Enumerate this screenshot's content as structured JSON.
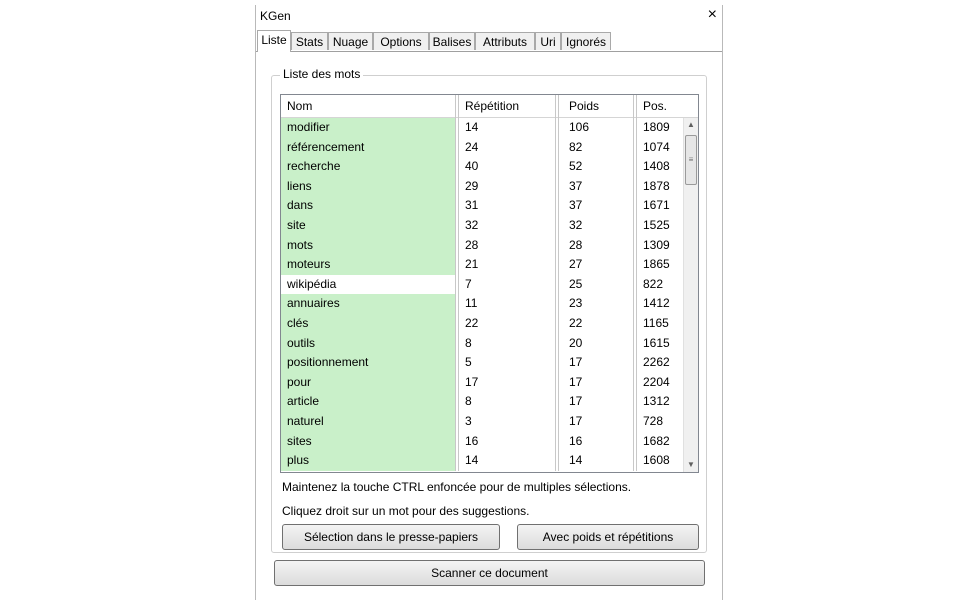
{
  "window": {
    "title": "KGen",
    "close_label": "×"
  },
  "tabs": [
    "Liste",
    "Stats",
    "Nuage",
    "Options",
    "Balises",
    "Attributs",
    "Uri",
    "Ignorés"
  ],
  "group": {
    "label": "Liste des mots"
  },
  "columns": [
    "Nom",
    "Répétition",
    "Poids",
    "Pos."
  ],
  "rows": [
    {
      "nom": "modifier",
      "repetition": "14",
      "poids": "106",
      "pos": "1809",
      "highlight": true
    },
    {
      "nom": "référencement",
      "repetition": "24",
      "poids": "82",
      "pos": "1074",
      "highlight": true
    },
    {
      "nom": "recherche",
      "repetition": "40",
      "poids": "52",
      "pos": "1408",
      "highlight": true
    },
    {
      "nom": "liens",
      "repetition": "29",
      "poids": "37",
      "pos": "1878",
      "highlight": true
    },
    {
      "nom": "dans",
      "repetition": "31",
      "poids": "37",
      "pos": "1671",
      "highlight": true
    },
    {
      "nom": "site",
      "repetition": "32",
      "poids": "32",
      "pos": "1525",
      "highlight": true
    },
    {
      "nom": "mots",
      "repetition": "28",
      "poids": "28",
      "pos": "1309",
      "highlight": true
    },
    {
      "nom": "moteurs",
      "repetition": "21",
      "poids": "27",
      "pos": "1865",
      "highlight": true
    },
    {
      "nom": "wikipédia",
      "repetition": "7",
      "poids": "25",
      "pos": "822",
      "highlight": false
    },
    {
      "nom": "annuaires",
      "repetition": "11",
      "poids": "23",
      "pos": "1412",
      "highlight": true
    },
    {
      "nom": "clés",
      "repetition": "22",
      "poids": "22",
      "pos": "1165",
      "highlight": true
    },
    {
      "nom": "outils",
      "repetition": "8",
      "poids": "20",
      "pos": "1615",
      "highlight": true
    },
    {
      "nom": "positionnement",
      "repetition": "5",
      "poids": "17",
      "pos": "2262",
      "highlight": true
    },
    {
      "nom": "pour",
      "repetition": "17",
      "poids": "17",
      "pos": "2204",
      "highlight": true
    },
    {
      "nom": "article",
      "repetition": "8",
      "poids": "17",
      "pos": "1312",
      "highlight": true
    },
    {
      "nom": "naturel",
      "repetition": "3",
      "poids": "17",
      "pos": "728",
      "highlight": true
    },
    {
      "nom": "sites",
      "repetition": "16",
      "poids": "16",
      "pos": "1682",
      "highlight": true
    },
    {
      "nom": "plus",
      "repetition": "14",
      "poids": "14",
      "pos": "1608",
      "highlight": true
    }
  ],
  "hints": {
    "ctrl": "Maintenez la touche CTRL enfoncée pour de multiples sélections.",
    "rightclick": "Cliquez droit sur un mot pour des suggestions."
  },
  "buttons": {
    "copy_selection": "Sélection dans le presse-papiers",
    "with_weights": "Avec poids et répétitions",
    "scan": "Scanner ce document"
  },
  "colors": {
    "highlight_row": "#c9f0c9"
  },
  "icons": {
    "scroll_up": "▲",
    "scroll_down": "▼",
    "thumb_grip": "≡"
  }
}
